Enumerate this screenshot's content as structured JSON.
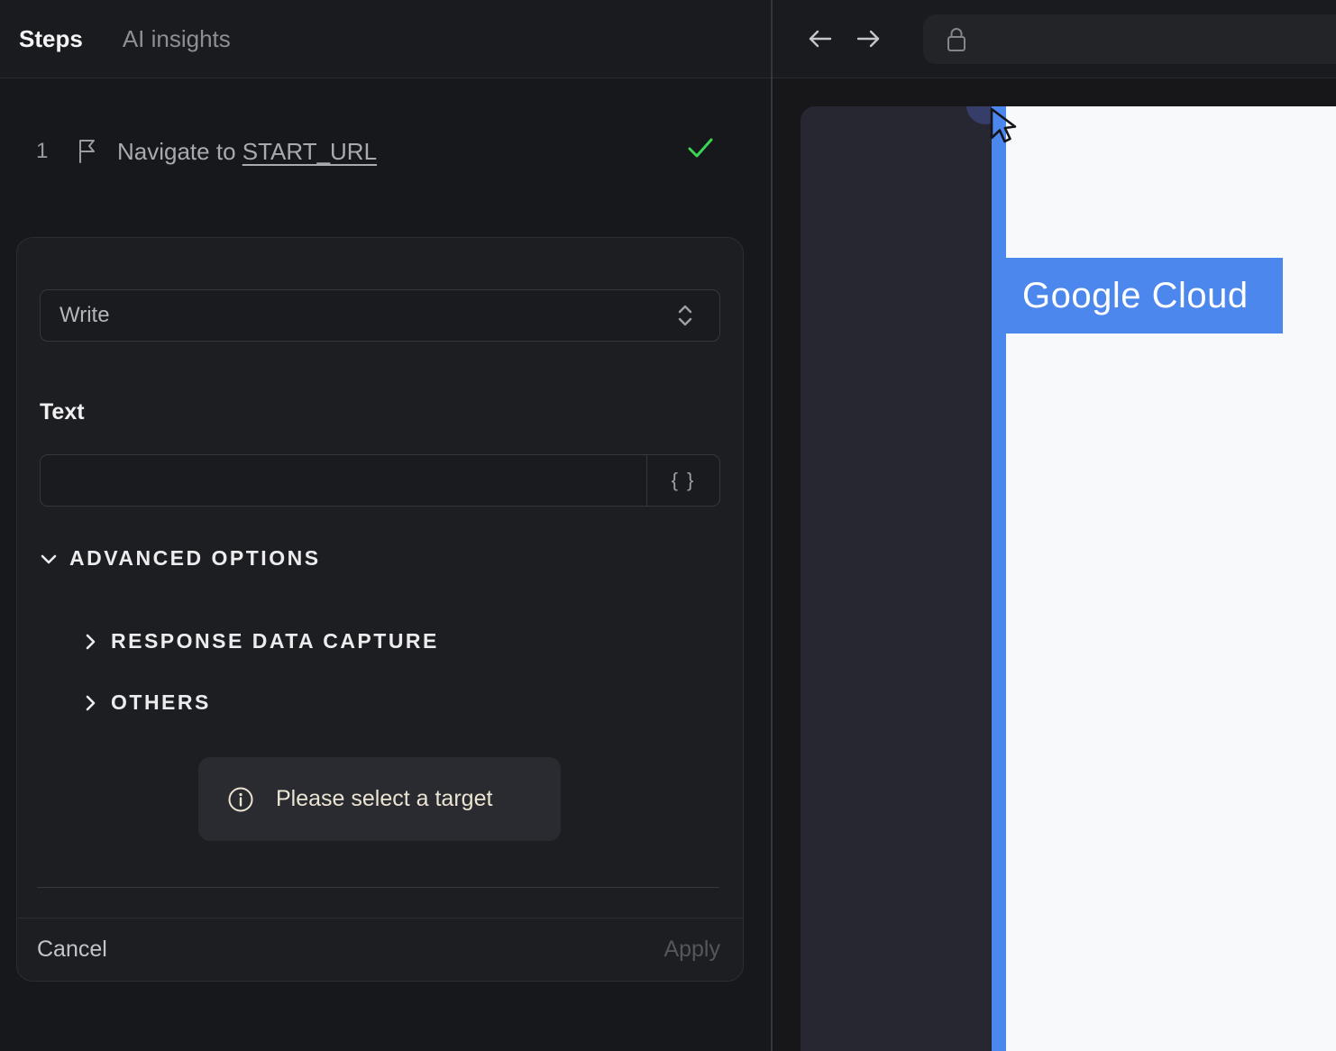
{
  "colors": {
    "accent_blue": "#4b87ec",
    "success_green": "#3bd453",
    "notice_cream": "#ece4d2",
    "panel_bg": "#17181b",
    "card_bg": "#1d1e22",
    "page_white": "#f8f9fa"
  },
  "left_panel": {
    "tabs": [
      {
        "label": "Steps",
        "active": true
      },
      {
        "label": "AI insights",
        "active": false
      }
    ],
    "step": {
      "index": "1",
      "action": "Navigate to ",
      "target": "START_URL",
      "status": "success"
    },
    "editor": {
      "action_select": {
        "value": "Write"
      },
      "text_field": {
        "label": "Text",
        "value": "",
        "placeholder": ""
      },
      "variables_button_label": "{ }",
      "advanced_label": "ADVANCED OPTIONS",
      "sections": [
        {
          "label": "RESPONSE DATA CAPTURE"
        },
        {
          "label": "OTHERS"
        }
      ],
      "notice_text": "Please select a target",
      "cancel_label": "Cancel",
      "apply_label": "Apply"
    }
  },
  "browser": {
    "url_value": "",
    "highlight_text": "Google Cloud"
  }
}
